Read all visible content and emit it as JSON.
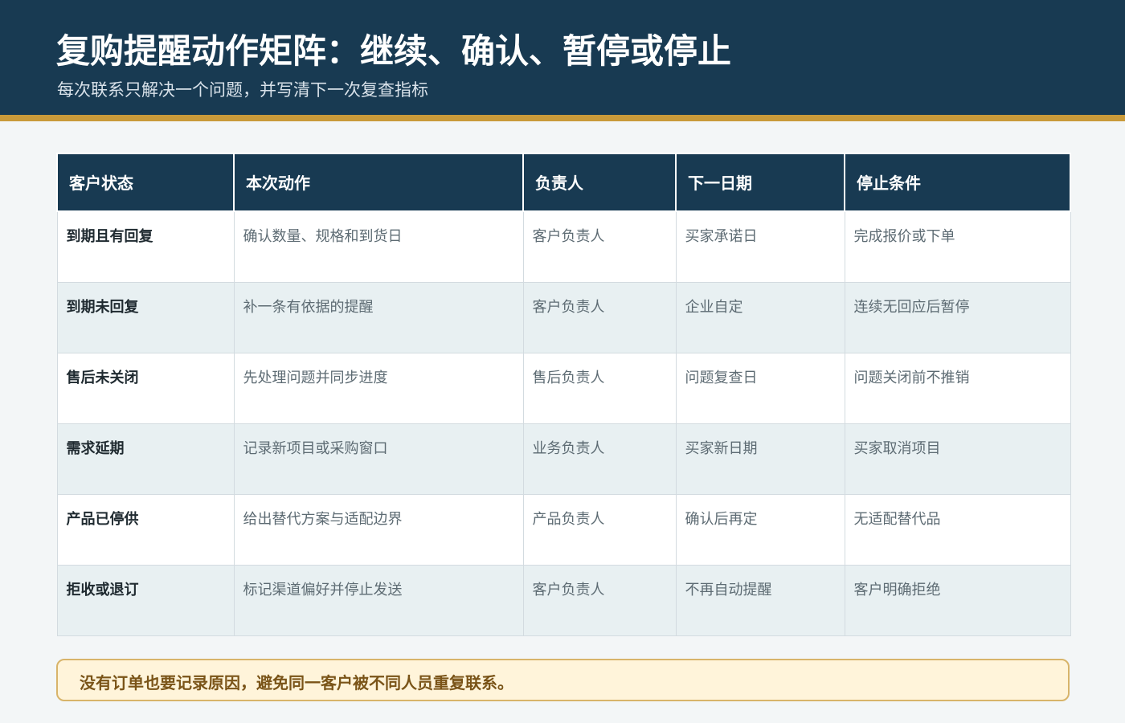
{
  "header": {
    "title": "复购提醒动作矩阵：继续、确认、暂停或停止",
    "subtitle": "每次联系只解决一个问题，并写清下一次复查指标"
  },
  "table": {
    "columns": [
      "客户状态",
      "本次动作",
      "负责人",
      "下一日期",
      "停止条件"
    ],
    "rows": [
      [
        "到期且有回复",
        "确认数量、规格和到货日",
        "客户负责人",
        "买家承诺日",
        "完成报价或下单"
      ],
      [
        "到期未回复",
        "补一条有依据的提醒",
        "客户负责人",
        "企业自定",
        "连续无回应后暂停"
      ],
      [
        "售后未关闭",
        "先处理问题并同步进度",
        "售后负责人",
        "问题复查日",
        "问题关闭前不推销"
      ],
      [
        "需求延期",
        "记录新项目或采购窗口",
        "业务负责人",
        "买家新日期",
        "买家取消项目"
      ],
      [
        "产品已停供",
        "给出替代方案与适配边界",
        "产品负责人",
        "确认后再定",
        "无适配替代品"
      ],
      [
        "拒收或退订",
        "标记渠道偏好并停止发送",
        "客户负责人",
        "不再自动提醒",
        "客户明确拒绝"
      ]
    ]
  },
  "note": "没有订单也要记录原因，避免同一客户被不同人员重复联系。",
  "colors": {
    "header_bg": "#183a52",
    "accent_gold": "#c99a3a",
    "note_bg": "#fff4da",
    "note_text": "#7a5418"
  }
}
